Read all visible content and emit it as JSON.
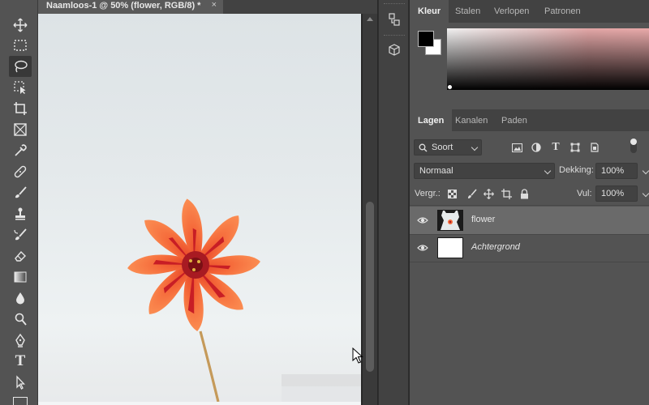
{
  "document": {
    "tab_title": "Naamloos-1 @ 50% (flower, RGB/8) *",
    "close_glyph": "×"
  },
  "toolbar": {
    "tools": [
      {
        "name": "move-tool",
        "icon": "move-icon"
      },
      {
        "name": "marquee-tool",
        "icon": "marquee-icon"
      },
      {
        "name": "lasso-tool",
        "icon": "lasso-icon",
        "active": true
      },
      {
        "name": "object-selection-tool",
        "icon": "object-select-icon"
      },
      {
        "name": "crop-tool",
        "icon": "crop-icon"
      },
      {
        "name": "frame-tool",
        "icon": "frame-icon"
      },
      {
        "name": "eyedropper-tool",
        "icon": "eyedropper-icon"
      },
      {
        "name": "healing-brush-tool",
        "icon": "bandage-icon"
      },
      {
        "name": "brush-tool",
        "icon": "brush-icon"
      },
      {
        "name": "clone-stamp-tool",
        "icon": "stamp-icon"
      },
      {
        "name": "history-brush-tool",
        "icon": "history-brush-icon"
      },
      {
        "name": "eraser-tool",
        "icon": "eraser-icon"
      },
      {
        "name": "gradient-tool",
        "icon": "gradient-icon"
      },
      {
        "name": "blur-tool",
        "icon": "drop-icon"
      },
      {
        "name": "dodge-tool",
        "icon": "dodge-icon"
      },
      {
        "name": "pen-tool",
        "icon": "pen-icon"
      },
      {
        "name": "type-tool",
        "icon": "type-icon",
        "glyph": "T"
      },
      {
        "name": "path-selection-tool",
        "icon": "arrow-icon"
      }
    ]
  },
  "dock": {
    "buttons": [
      {
        "name": "history-panel-button",
        "icon": "history-icon"
      },
      {
        "name": "3d-panel-button",
        "icon": "cube-icon"
      }
    ]
  },
  "color_panel": {
    "tabs": [
      "Kleur",
      "Stalen",
      "Verlopen",
      "Patronen"
    ],
    "active_tab": "Kleur",
    "foreground": "#000000",
    "background": "#ffffff"
  },
  "layers_panel": {
    "tabs": [
      "Lagen",
      "Kanalen",
      "Paden"
    ],
    "active_tab": "Lagen",
    "filter": {
      "label": "Soort"
    },
    "blend_mode": "Normaal",
    "opacity": {
      "label": "Dekking:",
      "value": "100%"
    },
    "lock": {
      "label": "Vergr.:"
    },
    "fill": {
      "label": "Vul:",
      "value": "100%"
    },
    "filter_icons": [
      "image-filter-icon",
      "adjustment-filter-icon",
      "type-filter-icon",
      "shape-filter-icon",
      "smart-object-filter-icon"
    ],
    "layers": [
      {
        "name": "flower",
        "visible": true,
        "selected": true,
        "italic": false
      },
      {
        "name": "Achtergrond",
        "visible": true,
        "selected": false,
        "italic": true
      }
    ]
  },
  "colors": {
    "panel_bg": "#535353",
    "dark_bg": "#282828",
    "tab_bar": "#424242",
    "selected_row": "#6a6a6a",
    "flower_orange": "#f26a3b",
    "flower_red": "#d4242a"
  }
}
